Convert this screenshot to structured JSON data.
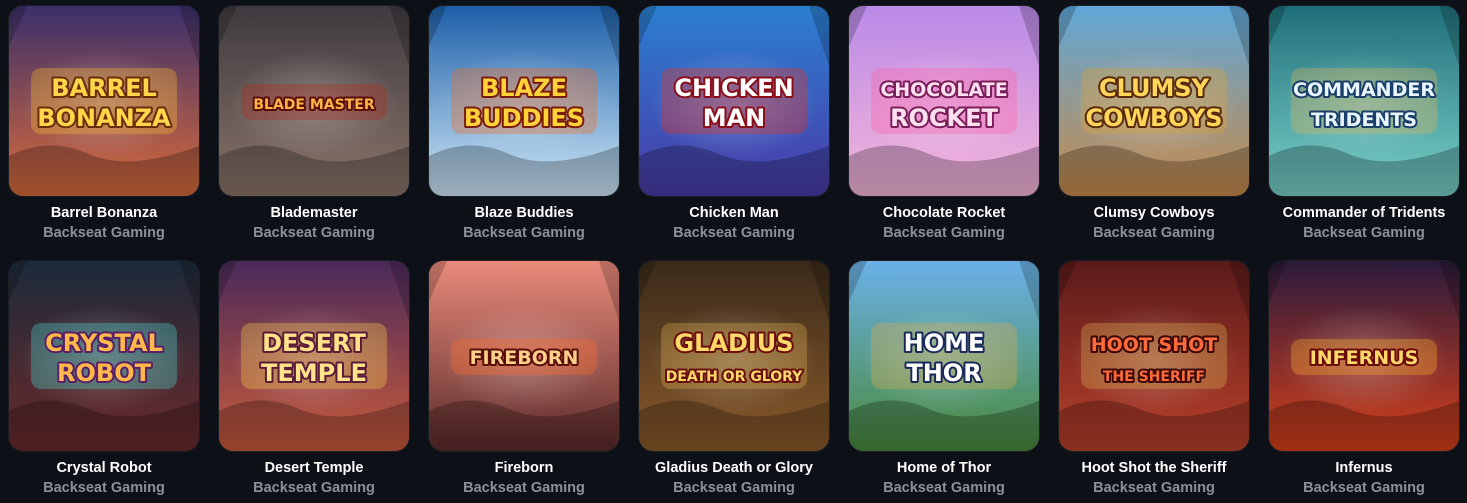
{
  "games": [
    {
      "title": "Barrel Bonanza",
      "provider": "Backseat Gaming",
      "logo": [
        "BARREL",
        "BONANZA"
      ],
      "bg": [
        "#3a2f6b",
        "#d86b3a"
      ],
      "accent": "#f5b82e",
      "logo_fill": "#ffd54a",
      "logo_stroke": "#6a2d0c"
    },
    {
      "title": "Blademaster",
      "provider": "Backseat Gaming",
      "logo": [
        "BLADE MASTER"
      ],
      "bg": [
        "#3e3a40",
        "#8a7468"
      ],
      "accent": "#b02a1e",
      "logo_fill": "#ffb347",
      "logo_stroke": "#5a0f0a"
    },
    {
      "title": "Blaze Buddies",
      "provider": "Backseat Gaming",
      "logo": [
        "BLAZE",
        "BUDDIES"
      ],
      "bg": [
        "#1d5fa8",
        "#cfe8f7"
      ],
      "accent": "#f06b1f",
      "logo_fill": "#ffd23a",
      "logo_stroke": "#7a1c0a"
    },
    {
      "title": "Chicken Man",
      "provider": "Backseat Gaming",
      "logo": [
        "CHICKEN",
        "MAN"
      ],
      "bg": [
        "#2a7fd1",
        "#4a3aa8"
      ],
      "accent": "#e8341f",
      "logo_fill": "#ffffff",
      "logo_stroke": "#8a0f1a"
    },
    {
      "title": "Chocolate Rocket",
      "provider": "Backseat Gaming",
      "logo": [
        "CHOCOLATE",
        "ROCKET"
      ],
      "bg": [
        "#b98ae8",
        "#f5b5d8"
      ],
      "accent": "#ff5fa2",
      "logo_fill": "#ffe0f0",
      "logo_stroke": "#7a1f5a"
    },
    {
      "title": "Clumsy Cowboys",
      "provider": "Backseat Gaming",
      "logo": [
        "CLUMSY",
        "COWBOYS"
      ],
      "bg": [
        "#5fa7d8",
        "#c88a4a"
      ],
      "accent": "#d9a13a",
      "logo_fill": "#ffd65a",
      "logo_stroke": "#5a2a0c"
    },
    {
      "title": "Commander of Tridents",
      "provider": "Backseat Gaming",
      "logo": [
        "COMMANDER",
        "TRIDENTS"
      ],
      "bg": [
        "#1f6f7a",
        "#7ad0c8"
      ],
      "accent": "#d8b45a",
      "logo_fill": "#e8f6ff",
      "logo_stroke": "#1c3f6a"
    },
    {
      "title": "Crystal Robot",
      "provider": "Backseat Gaming",
      "logo": [
        "CRYSTAL",
        "ROBOT"
      ],
      "bg": [
        "#1c2a3a",
        "#6a2a2a"
      ],
      "accent": "#4ad0c8",
      "logo_fill": "#ffb84a",
      "logo_stroke": "#5a1f6a"
    },
    {
      "title": "Desert Temple",
      "provider": "Backseat Gaming",
      "logo": [
        "DESERT",
        "TEMPLE"
      ],
      "bg": [
        "#4a2a5a",
        "#c85a3a"
      ],
      "accent": "#f5c84a",
      "logo_fill": "#ffe28a",
      "logo_stroke": "#5a1a3a"
    },
    {
      "title": "Fireborn",
      "provider": "Backseat Gaming",
      "logo": [
        "FIREBORN"
      ],
      "bg": [
        "#e88a7a",
        "#5a2a2a"
      ],
      "accent": "#ff6a2a",
      "logo_fill": "#ffd08a",
      "logo_stroke": "#5a0f0a"
    },
    {
      "title": "Gladius Death or Glory",
      "provider": "Backseat Gaming",
      "logo": [
        "GLADIUS",
        "DEATH OR GLORY"
      ],
      "bg": [
        "#3a2a1a",
        "#8a5a2a"
      ],
      "accent": "#d8a84a",
      "logo_fill": "#ffd86a",
      "logo_stroke": "#6a0f0f"
    },
    {
      "title": "Home of Thor",
      "provider": "Backseat Gaming",
      "logo": [
        "HOME",
        "THOR"
      ],
      "bg": [
        "#6ab0e8",
        "#4a8a3a"
      ],
      "accent": "#d8a84a",
      "logo_fill": "#ffffff",
      "logo_stroke": "#1a2a5a"
    },
    {
      "title": "Hoot Shot the Sheriff",
      "provider": "Backseat Gaming",
      "logo": [
        "HOOT SHOT",
        "THE SHERIFF"
      ],
      "bg": [
        "#5a1a1a",
        "#b8402a"
      ],
      "accent": "#d8a84a",
      "logo_fill": "#ff6a3a",
      "logo_stroke": "#3a0a0a"
    },
    {
      "title": "Infernus",
      "provider": "Backseat Gaming",
      "logo": [
        "INFERNUS"
      ],
      "bg": [
        "#2a1a3a",
        "#d8401a"
      ],
      "accent": "#ffaa2a",
      "logo_fill": "#ffd86a",
      "logo_stroke": "#6a0a0a"
    }
  ]
}
